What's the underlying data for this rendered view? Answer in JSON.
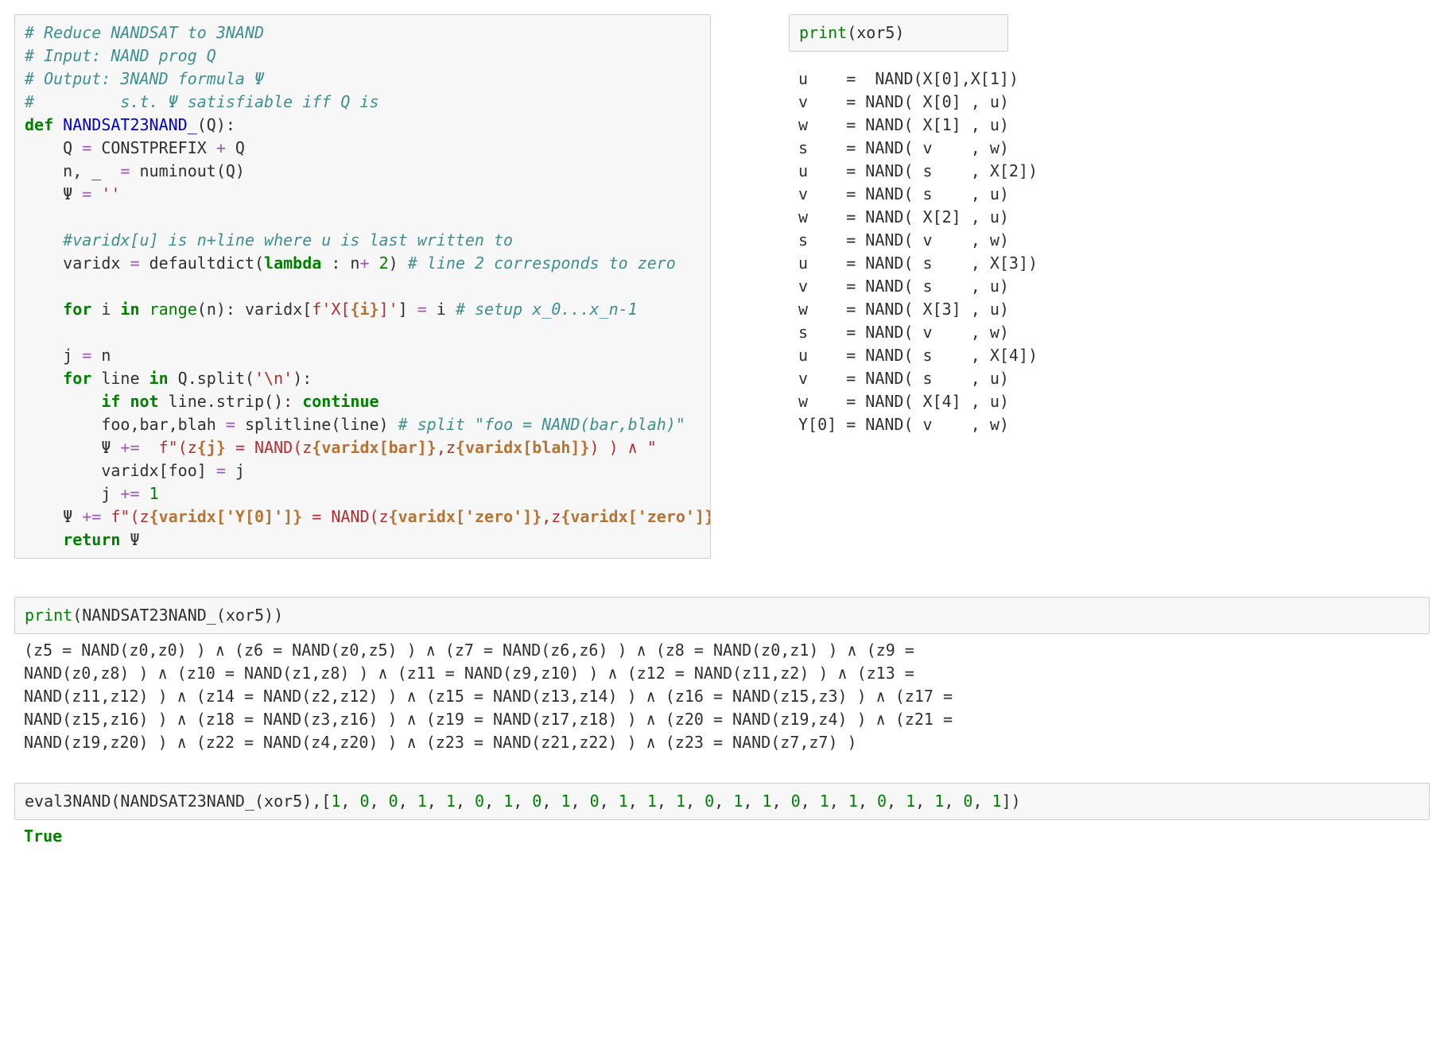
{
  "top_left_code": {
    "tokens": [
      {
        "cls": "c",
        "t": "# Reduce NANDSAT to 3NAND"
      },
      "\n",
      {
        "cls": "c",
        "t": "# Input: NAND prog Q"
      },
      "\n",
      {
        "cls": "c",
        "t": "# Output: 3NAND formula Ψ"
      },
      "\n",
      {
        "cls": "c",
        "t": "#         s.t. Ψ satisfiable iff Q is"
      },
      "\n",
      {
        "cls": "k",
        "t": "def"
      },
      " ",
      {
        "cls": "nf",
        "t": "NANDSAT23NAND_"
      },
      "(Q):",
      "\n",
      "    Q ",
      {
        "cls": "op",
        "t": "="
      },
      " CONSTPREFIX ",
      {
        "cls": "op",
        "t": "+"
      },
      " Q",
      "\n",
      "    n, _  ",
      {
        "cls": "op",
        "t": "="
      },
      " numinout(Q)",
      "\n",
      "    Ψ ",
      {
        "cls": "op",
        "t": "="
      },
      " ",
      {
        "cls": "s",
        "t": "''"
      },
      "\n",
      "\n",
      "    ",
      {
        "cls": "c",
        "t": "#varidx[u] is n+line where u is last written to"
      },
      "\n",
      "    varidx ",
      {
        "cls": "op",
        "t": "="
      },
      " defaultdict(",
      {
        "cls": "k",
        "t": "lambda"
      },
      " : n",
      {
        "cls": "op",
        "t": "+"
      },
      " ",
      {
        "cls": "n",
        "t": "2"
      },
      ") ",
      {
        "cls": "c",
        "t": "# line 2 corresponds to zero"
      },
      "\n",
      "\n",
      "    ",
      {
        "cls": "k",
        "t": "for"
      },
      " i ",
      {
        "cls": "k",
        "t": "in"
      },
      " ",
      {
        "cls": "builtin",
        "t": "range"
      },
      "(n): varidx[",
      {
        "cls": "s",
        "t": "f'X["
      },
      {
        "cls": "si",
        "t": "{i}"
      },
      {
        "cls": "s",
        "t": "]'"
      },
      "] ",
      {
        "cls": "op",
        "t": "="
      },
      " i ",
      {
        "cls": "c",
        "t": "# setup x_0...x_n-1"
      },
      "\n",
      "\n",
      "    j ",
      {
        "cls": "op",
        "t": "="
      },
      " n",
      "\n",
      "    ",
      {
        "cls": "k",
        "t": "for"
      },
      " line ",
      {
        "cls": "k",
        "t": "in"
      },
      " Q.split(",
      {
        "cls": "s",
        "t": "'\\n'"
      },
      "):",
      "\n",
      "        ",
      {
        "cls": "k",
        "t": "if"
      },
      " ",
      {
        "cls": "k",
        "t": "not"
      },
      " line.strip(): ",
      {
        "cls": "k",
        "t": "continue"
      },
      "\n",
      "        foo,bar,blah ",
      {
        "cls": "op",
        "t": "="
      },
      " splitline(line) ",
      {
        "cls": "c",
        "t": "# split \"foo = NAND(bar,blah)\""
      },
      "\n",
      "        Ψ ",
      {
        "cls": "op",
        "t": "+="
      },
      "  ",
      {
        "cls": "s",
        "t": "f\"(z"
      },
      {
        "cls": "si",
        "t": "{j}"
      },
      {
        "cls": "s",
        "t": " = NAND(z"
      },
      {
        "cls": "si",
        "t": "{varidx[bar]}"
      },
      {
        "cls": "s",
        "t": ",z"
      },
      {
        "cls": "si",
        "t": "{varidx[blah]}"
      },
      {
        "cls": "s",
        "t": ") ) ∧ \""
      },
      "\n",
      "        varidx[foo] ",
      {
        "cls": "op",
        "t": "="
      },
      " j",
      "\n",
      "        j ",
      {
        "cls": "op",
        "t": "+="
      },
      " ",
      {
        "cls": "n",
        "t": "1"
      },
      "\n",
      "    Ψ ",
      {
        "cls": "op",
        "t": "+="
      },
      " ",
      {
        "cls": "s",
        "t": "f\"(z"
      },
      {
        "cls": "si",
        "t": "{varidx['Y[0]']}"
      },
      {
        "cls": "s",
        "t": " = NAND(z"
      },
      {
        "cls": "si",
        "t": "{varidx['zero']}"
      },
      {
        "cls": "s",
        "t": ",z"
      },
      {
        "cls": "si",
        "t": "{varidx['zero']}"
      },
      {
        "cls": "s",
        "t": ") )\""
      },
      "\n",
      "    ",
      {
        "cls": "k",
        "t": "return"
      },
      " Ψ"
    ]
  },
  "top_right_input": {
    "tokens": [
      {
        "cls": "builtin",
        "t": "print"
      },
      "(xor5)"
    ]
  },
  "top_right_output": "u    =  NAND(X[0],X[1])\nv    = NAND( X[0] , u)\nw    = NAND( X[1] , u)\ns    = NAND( v    , w)\nu    = NAND( s    , X[2])\nv    = NAND( s    , u)\nw    = NAND( X[2] , u)\ns    = NAND( v    , w)\nu    = NAND( s    , X[3])\nv    = NAND( s    , u)\nw    = NAND( X[3] , u)\ns    = NAND( v    , w)\nu    = NAND( s    , X[4])\nv    = NAND( s    , u)\nw    = NAND( X[4] , u)\nY[0] = NAND( v    , w)",
  "mid_input": {
    "tokens": [
      {
        "cls": "builtin",
        "t": "print"
      },
      "(NANDSAT23NAND_(xor5))"
    ]
  },
  "mid_output": "(z5 = NAND(z0,z0) ) ∧ (z6 = NAND(z0,z5) ) ∧ (z7 = NAND(z6,z6) ) ∧ (z8 = NAND(z0,z1) ) ∧ (z9 = NAND(z0,z8) ) ∧ (z10 = NAND(z1,z8) ) ∧ (z11 = NAND(z9,z10) ) ∧ (z12 = NAND(z11,z2) ) ∧ (z13 = NAND(z11,z12) ) ∧ (z14 = NAND(z2,z12) ) ∧ (z15 = NAND(z13,z14) ) ∧ (z16 = NAND(z15,z3) ) ∧ (z17 = NAND(z15,z16) ) ∧ (z18 = NAND(z3,z16) ) ∧ (z19 = NAND(z17,z18) ) ∧ (z20 = NAND(z19,z4) ) ∧ (z21 = NAND(z19,z20) ) ∧ (z22 = NAND(z4,z20) ) ∧ (z23 = NAND(z21,z22) ) ∧ (z23 = NAND(z7,z7) )",
  "bottom_input": {
    "tokens": [
      "eval3NAND(NANDSAT23NAND_(xor5),[",
      {
        "cls": "n",
        "t": "1"
      },
      ", ",
      {
        "cls": "n",
        "t": "0"
      },
      ", ",
      {
        "cls": "n",
        "t": "0"
      },
      ", ",
      {
        "cls": "n",
        "t": "1"
      },
      ", ",
      {
        "cls": "n",
        "t": "1"
      },
      ", ",
      {
        "cls": "n",
        "t": "0"
      },
      ", ",
      {
        "cls": "n",
        "t": "1"
      },
      ", ",
      {
        "cls": "n",
        "t": "0"
      },
      ", ",
      {
        "cls": "n",
        "t": "1"
      },
      ", ",
      {
        "cls": "n",
        "t": "0"
      },
      ", ",
      {
        "cls": "n",
        "t": "1"
      },
      ", ",
      {
        "cls": "n",
        "t": "1"
      },
      ", ",
      {
        "cls": "n",
        "t": "1"
      },
      ", ",
      {
        "cls": "n",
        "t": "0"
      },
      ", ",
      {
        "cls": "n",
        "t": "1"
      },
      ", ",
      {
        "cls": "n",
        "t": "1"
      },
      ", ",
      {
        "cls": "n",
        "t": "0"
      },
      ", ",
      {
        "cls": "n",
        "t": "1"
      },
      ", ",
      {
        "cls": "n",
        "t": "1"
      },
      ", ",
      {
        "cls": "n",
        "t": "0"
      },
      ", ",
      {
        "cls": "n",
        "t": "1"
      },
      ", ",
      {
        "cls": "n",
        "t": "1"
      },
      ", ",
      {
        "cls": "n",
        "t": "0"
      },
      ", ",
      {
        "cls": "n",
        "t": "1"
      },
      "])"
    ]
  },
  "bottom_output": "True"
}
